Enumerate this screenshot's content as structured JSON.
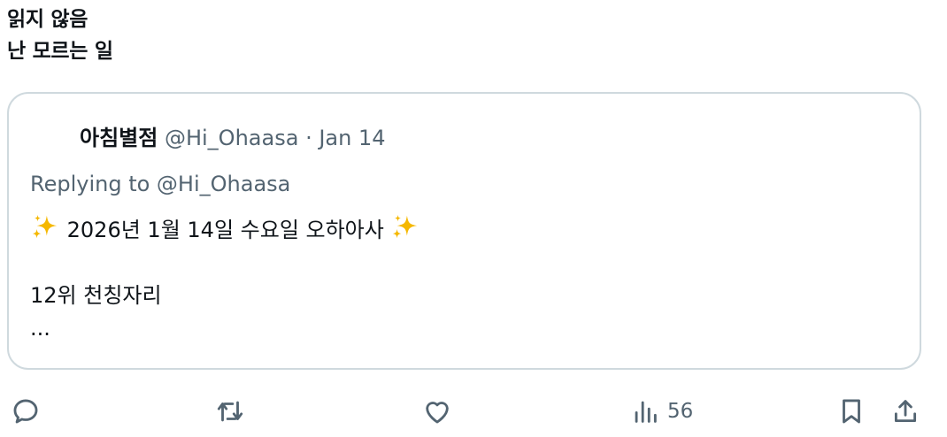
{
  "tweet": {
    "lines": [
      "읽지 않음",
      "난 모르는 일"
    ]
  },
  "quote": {
    "name": "아침별점",
    "handle": "@Hi_Ohaasa",
    "separator": "·",
    "date": "Jan 14",
    "replying": "Replying to @Hi_Ohaasa",
    "body_line1": "2026년 1월 14일 수요일 오하아사",
    "body_line2": "12위 천칭자리",
    "body_more": "...",
    "emoji": "sparkles-icon"
  },
  "actions": {
    "reply_icon": "reply-icon",
    "retweet_icon": "retweet-icon",
    "like_icon": "like-icon",
    "views_icon": "views-icon",
    "views_count": "56",
    "bookmark_icon": "bookmark-icon",
    "share_icon": "share-icon"
  },
  "colors": {
    "text": "#0f1419",
    "secondary": "#536471",
    "border": "#cfd9de",
    "sparkle": "#f5b800"
  }
}
